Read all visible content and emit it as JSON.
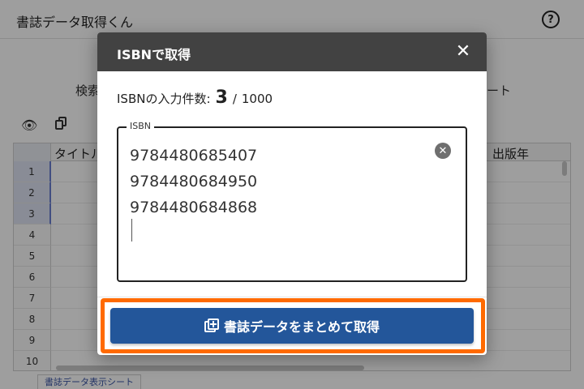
{
  "app": {
    "title": "書誌データ取得くん",
    "help_icon": "help-circle-icon",
    "tab_left_partial": "検索",
    "tab_right_partial": "ート",
    "toolbar": {
      "view_icon": "eye-icon",
      "copy_icon": "copy-icon"
    },
    "grid": {
      "columns": [
        "タイトル",
        "出版年"
      ],
      "rows": [
        "1",
        "2",
        "3",
        "4",
        "5",
        "6",
        "7",
        "8",
        "9",
        "10"
      ]
    },
    "sheet_tab": "書誌データ表示シート"
  },
  "modal": {
    "title": "ISBNで取得",
    "close_icon": "close-icon",
    "count_label": "ISBNの入力件数:",
    "count_value": "3",
    "count_separator": "/",
    "count_max": "1000",
    "field_label": "ISBN",
    "isbn_values": [
      "9784480685407",
      "9784480684950",
      "9784480684868"
    ],
    "clear_icon": "clear-circle-icon",
    "submit_label": "書誌データをまとめて取得",
    "submit_icon": "library-add-icon",
    "highlight_color": "#ff6a00",
    "button_color": "#23569a"
  }
}
